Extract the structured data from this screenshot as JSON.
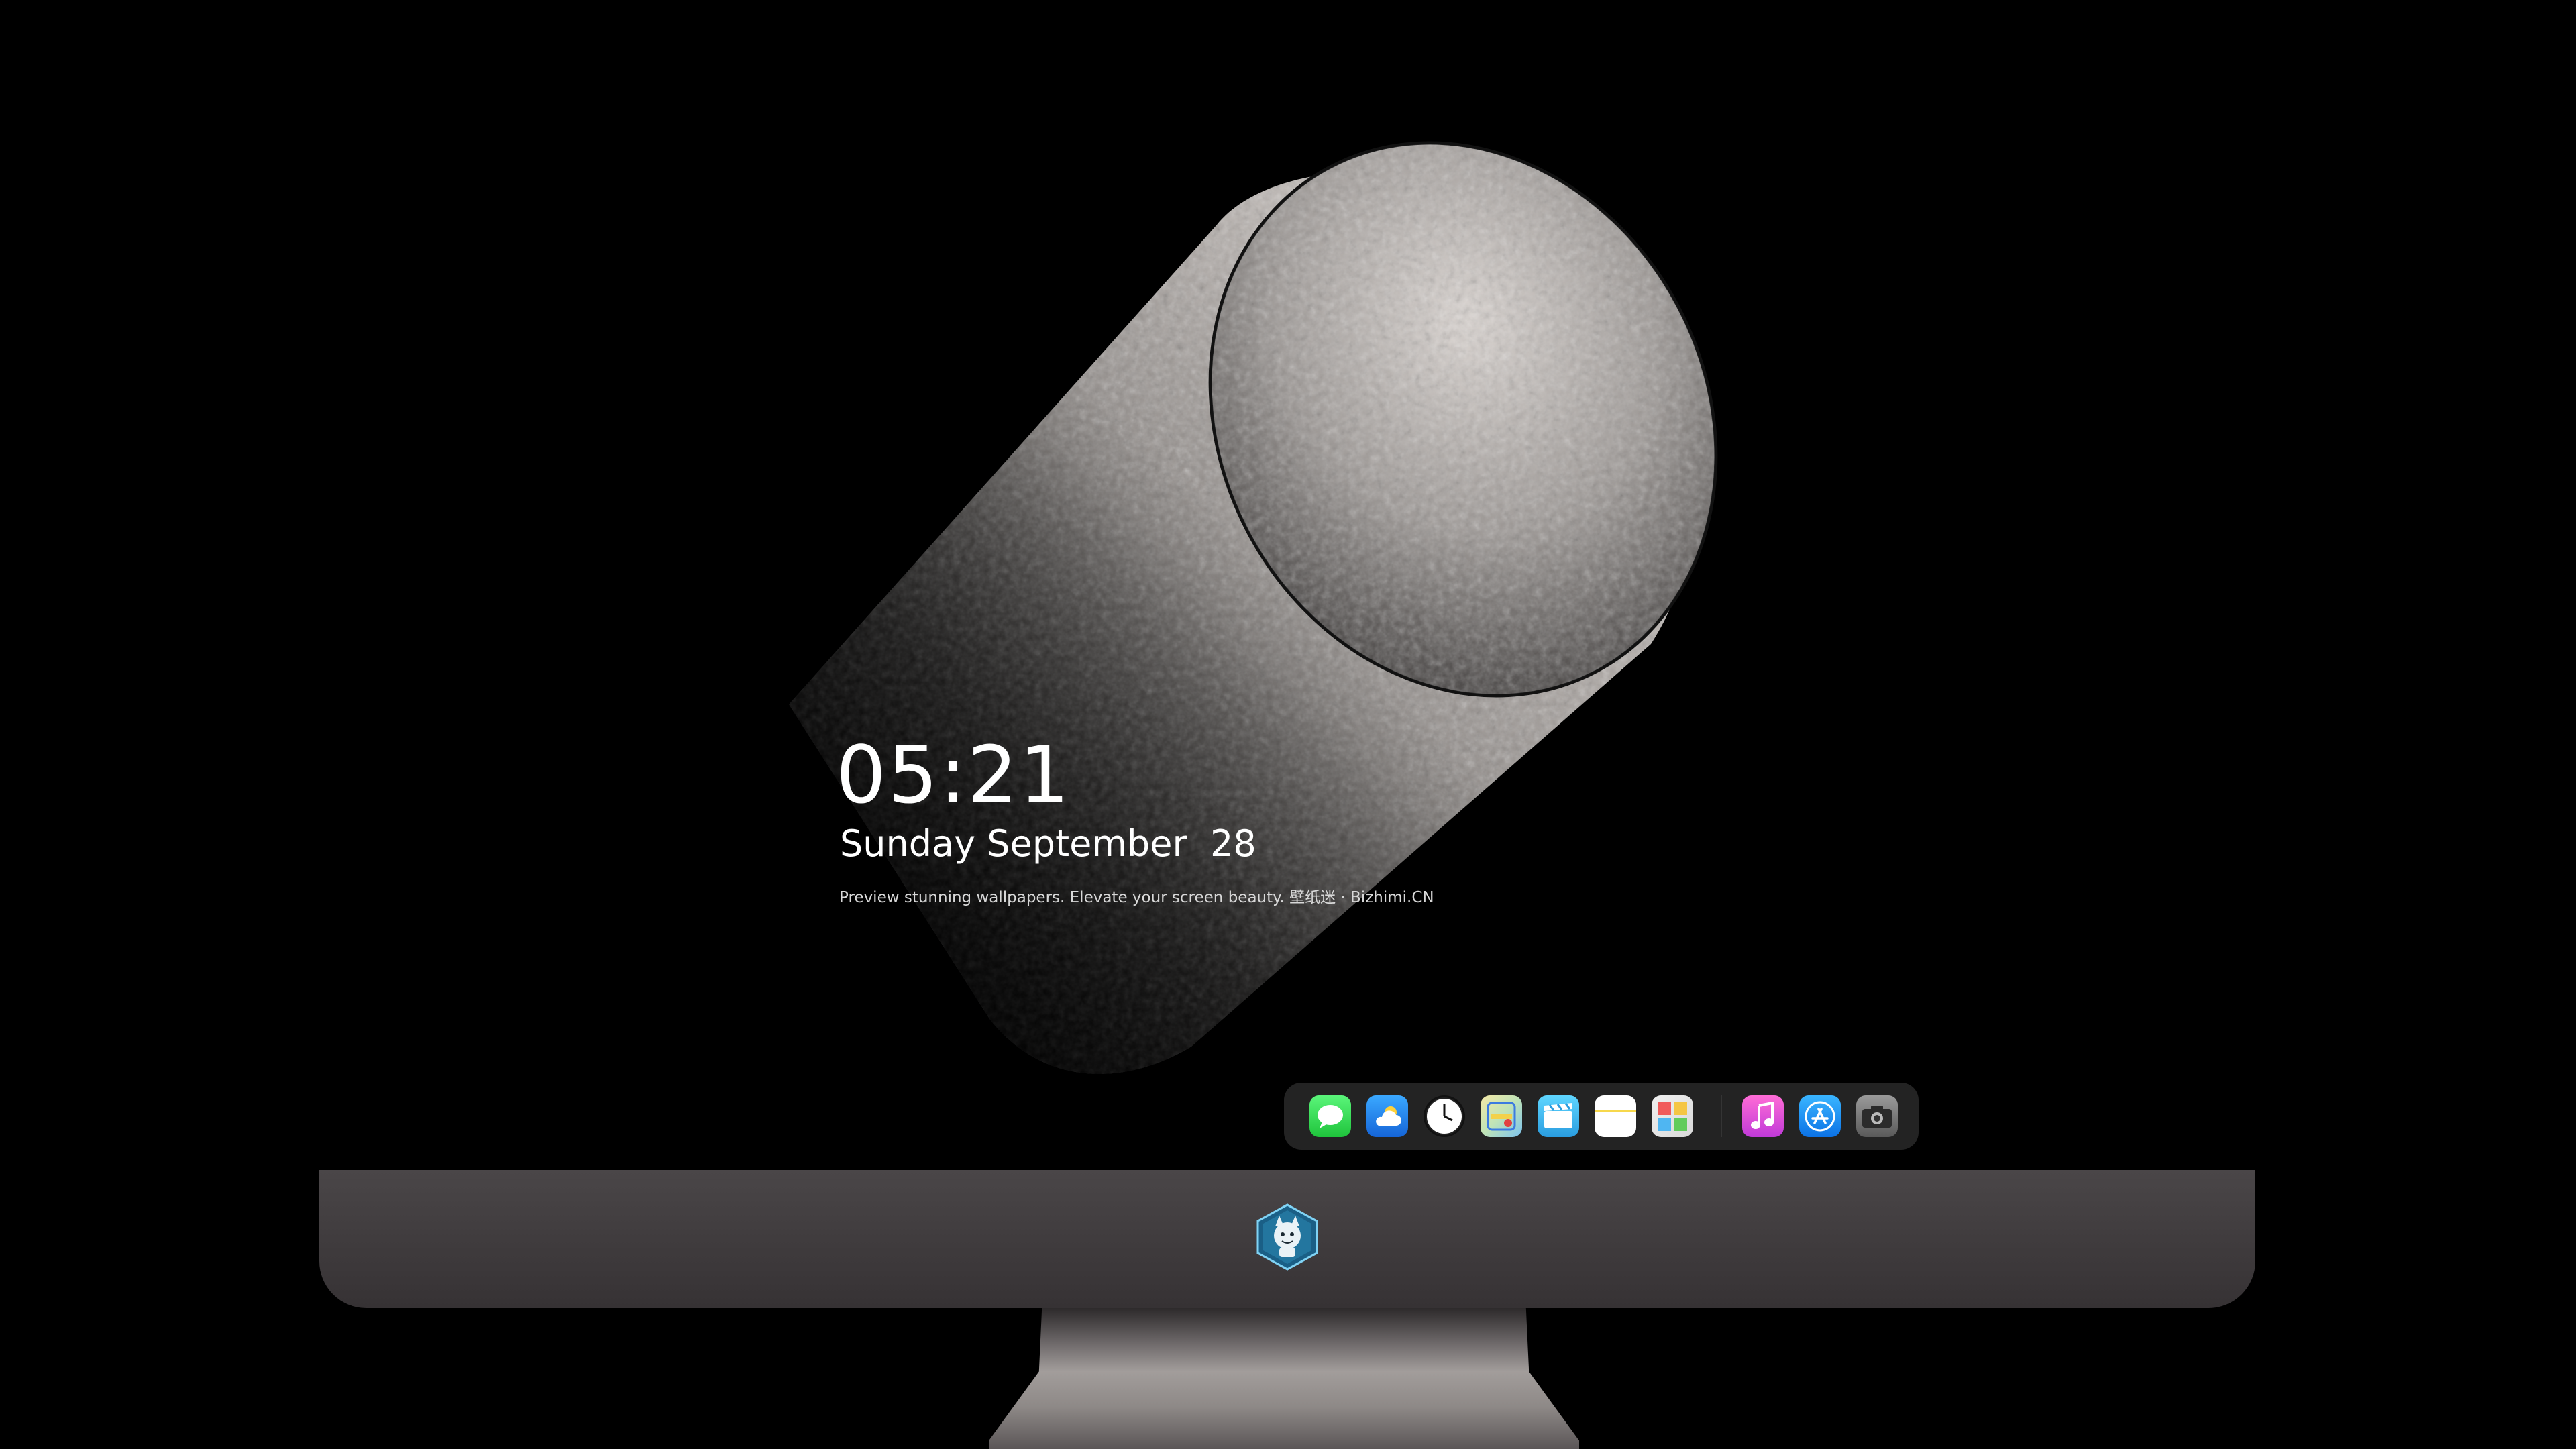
{
  "lockscreen": {
    "time": "05:21",
    "date": "Sunday September  28",
    "tagline": "Preview stunning wallpapers. Elevate your screen beauty. 壁纸迷 · Bizhimi.CN"
  },
  "dock": {
    "apps": [
      {
        "name": "Messages",
        "icon": "messages-icon"
      },
      {
        "name": "Weather",
        "icon": "weather-icon"
      },
      {
        "name": "Clock",
        "icon": "clock-icon"
      },
      {
        "name": "Maps",
        "icon": "maps-icon"
      },
      {
        "name": "Clips",
        "icon": "clips-icon"
      },
      {
        "name": "Notes",
        "icon": "notes-icon"
      },
      {
        "name": "Photos",
        "icon": "photos-icon"
      },
      {
        "name": "Music",
        "icon": "music-icon"
      },
      {
        "name": "App Store",
        "icon": "app-store-icon"
      },
      {
        "name": "Camera",
        "icon": "camera-icon"
      }
    ]
  },
  "colors": {
    "background": "#000000",
    "chin": "#433f41",
    "cylinder": "#c9c3bf"
  }
}
